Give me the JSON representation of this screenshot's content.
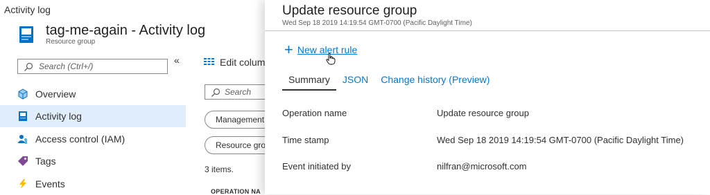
{
  "breadcrumb": "Activity log",
  "resource": {
    "title": "tag-me-again - Activity log",
    "subtitle": "Resource group"
  },
  "sidebar": {
    "collapse_glyph": "«",
    "search_placeholder": "Search (Ctrl+/)",
    "items": [
      {
        "label": "Overview",
        "icon": "overview-icon",
        "active": false
      },
      {
        "label": "Activity log",
        "icon": "activity-log-icon",
        "active": true
      },
      {
        "label": "Access control (IAM)",
        "icon": "access-control-icon",
        "active": false
      },
      {
        "label": "Tags",
        "icon": "tag-icon",
        "active": false
      },
      {
        "label": "Events",
        "icon": "lightning-icon",
        "active": false
      }
    ]
  },
  "main": {
    "edit_columns_label": "Edit column",
    "search_placeholder": "Search",
    "filters": [
      "Management",
      "Resource gro"
    ],
    "items_count": "3 items.",
    "column_header": "OPERATION NA"
  },
  "panel": {
    "title": "Update resource group",
    "timestamp_subtitle": "Wed Sep 18 2019 14:19:54 GMT-0700 (Pacific Daylight Time)",
    "new_alert_rule": "New alert rule",
    "tabs": [
      {
        "label": "Summary",
        "active": true
      },
      {
        "label": "JSON",
        "active": false
      },
      {
        "label": "Change history (Preview)",
        "active": false
      }
    ],
    "rows": [
      {
        "label": "Operation name",
        "value": "Update resource group"
      },
      {
        "label": "Time stamp",
        "value": "Wed Sep 18 2019 14:19:54 GMT-0700 (Pacific Daylight Time)"
      },
      {
        "label": "Event initiated by",
        "value": "nilfran@microsoft.com"
      }
    ]
  },
  "colors": {
    "accent": "#0078d4",
    "active_nav_bg": "#dfeefa",
    "text": "#323130"
  }
}
